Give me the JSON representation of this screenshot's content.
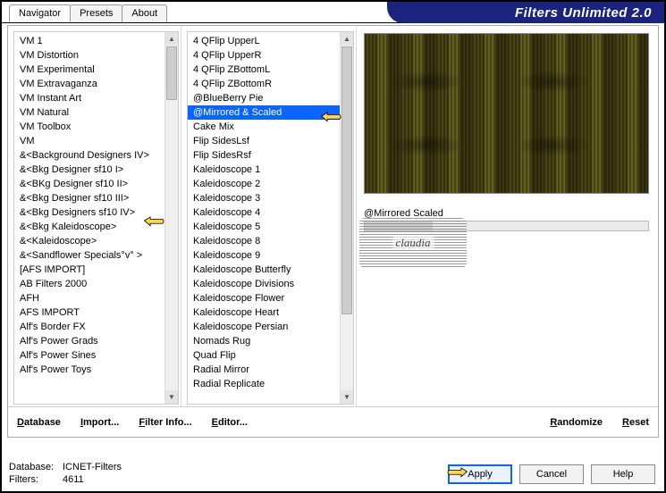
{
  "title": "Filters Unlimited 2.0",
  "tabs": [
    "Navigator",
    "Presets",
    "About"
  ],
  "activeTab": 0,
  "categories": [
    "VM 1",
    "VM Distortion",
    "VM Experimental",
    "VM Extravaganza",
    "VM Instant Art",
    "VM Natural",
    "VM Toolbox",
    "VM",
    "&<Background Designers IV>",
    "&<Bkg Designer sf10 I>",
    "&<BKg Designer sf10 II>",
    "&<Bkg Designer sf10 III>",
    "&<Bkg Designers sf10 IV>",
    "&<Bkg Kaleidoscope>",
    "&<Kaleidoscope>",
    "&<Sandflower Specials°v° >",
    "[AFS IMPORT]",
    "AB Filters 2000",
    "AFH",
    "AFS IMPORT",
    "Alf's Border FX",
    "Alf's Power Grads",
    "Alf's Power Sines",
    "Alf's Power Toys"
  ],
  "filters": [
    "4 QFlip UpperL",
    "4 QFlip UpperR",
    "4 QFlip ZBottomL",
    "4 QFlip ZBottomR",
    "@BlueBerry Pie",
    "@Mirrored & Scaled",
    "Cake Mix",
    "Flip SidesLsf",
    "Flip SidesRsf",
    "Kaleidoscope 1",
    "Kaleidoscope 2",
    "Kaleidoscope 3",
    "Kaleidoscope 4",
    "Kaleidoscope 5",
    "Kaleidoscope 8",
    "Kaleidoscope 9",
    "Kaleidoscope Butterfly",
    "Kaleidoscope Divisions",
    "Kaleidoscope Flower",
    "Kaleidoscope Heart",
    "Kaleidoscope Persian",
    "Nomads Rug",
    "Quad Flip",
    "Radial Mirror",
    "Radial Replicate"
  ],
  "selectedFilterIndex": 5,
  "paramLabel": "@Mirrored  Scaled",
  "bottomButtons": {
    "database": "Database",
    "import": "Import...",
    "filterInfo": "Filter Info...",
    "editor": "Editor...",
    "randomize": "Randomize",
    "reset": "Reset"
  },
  "status": {
    "dbLabel": "Database:",
    "dbValue": "ICNET-Filters",
    "filtersLabel": "Filters:",
    "filtersValue": "4611"
  },
  "actions": {
    "apply": "Apply",
    "cancel": "Cancel",
    "help": "Help"
  },
  "watermark": "claudia"
}
